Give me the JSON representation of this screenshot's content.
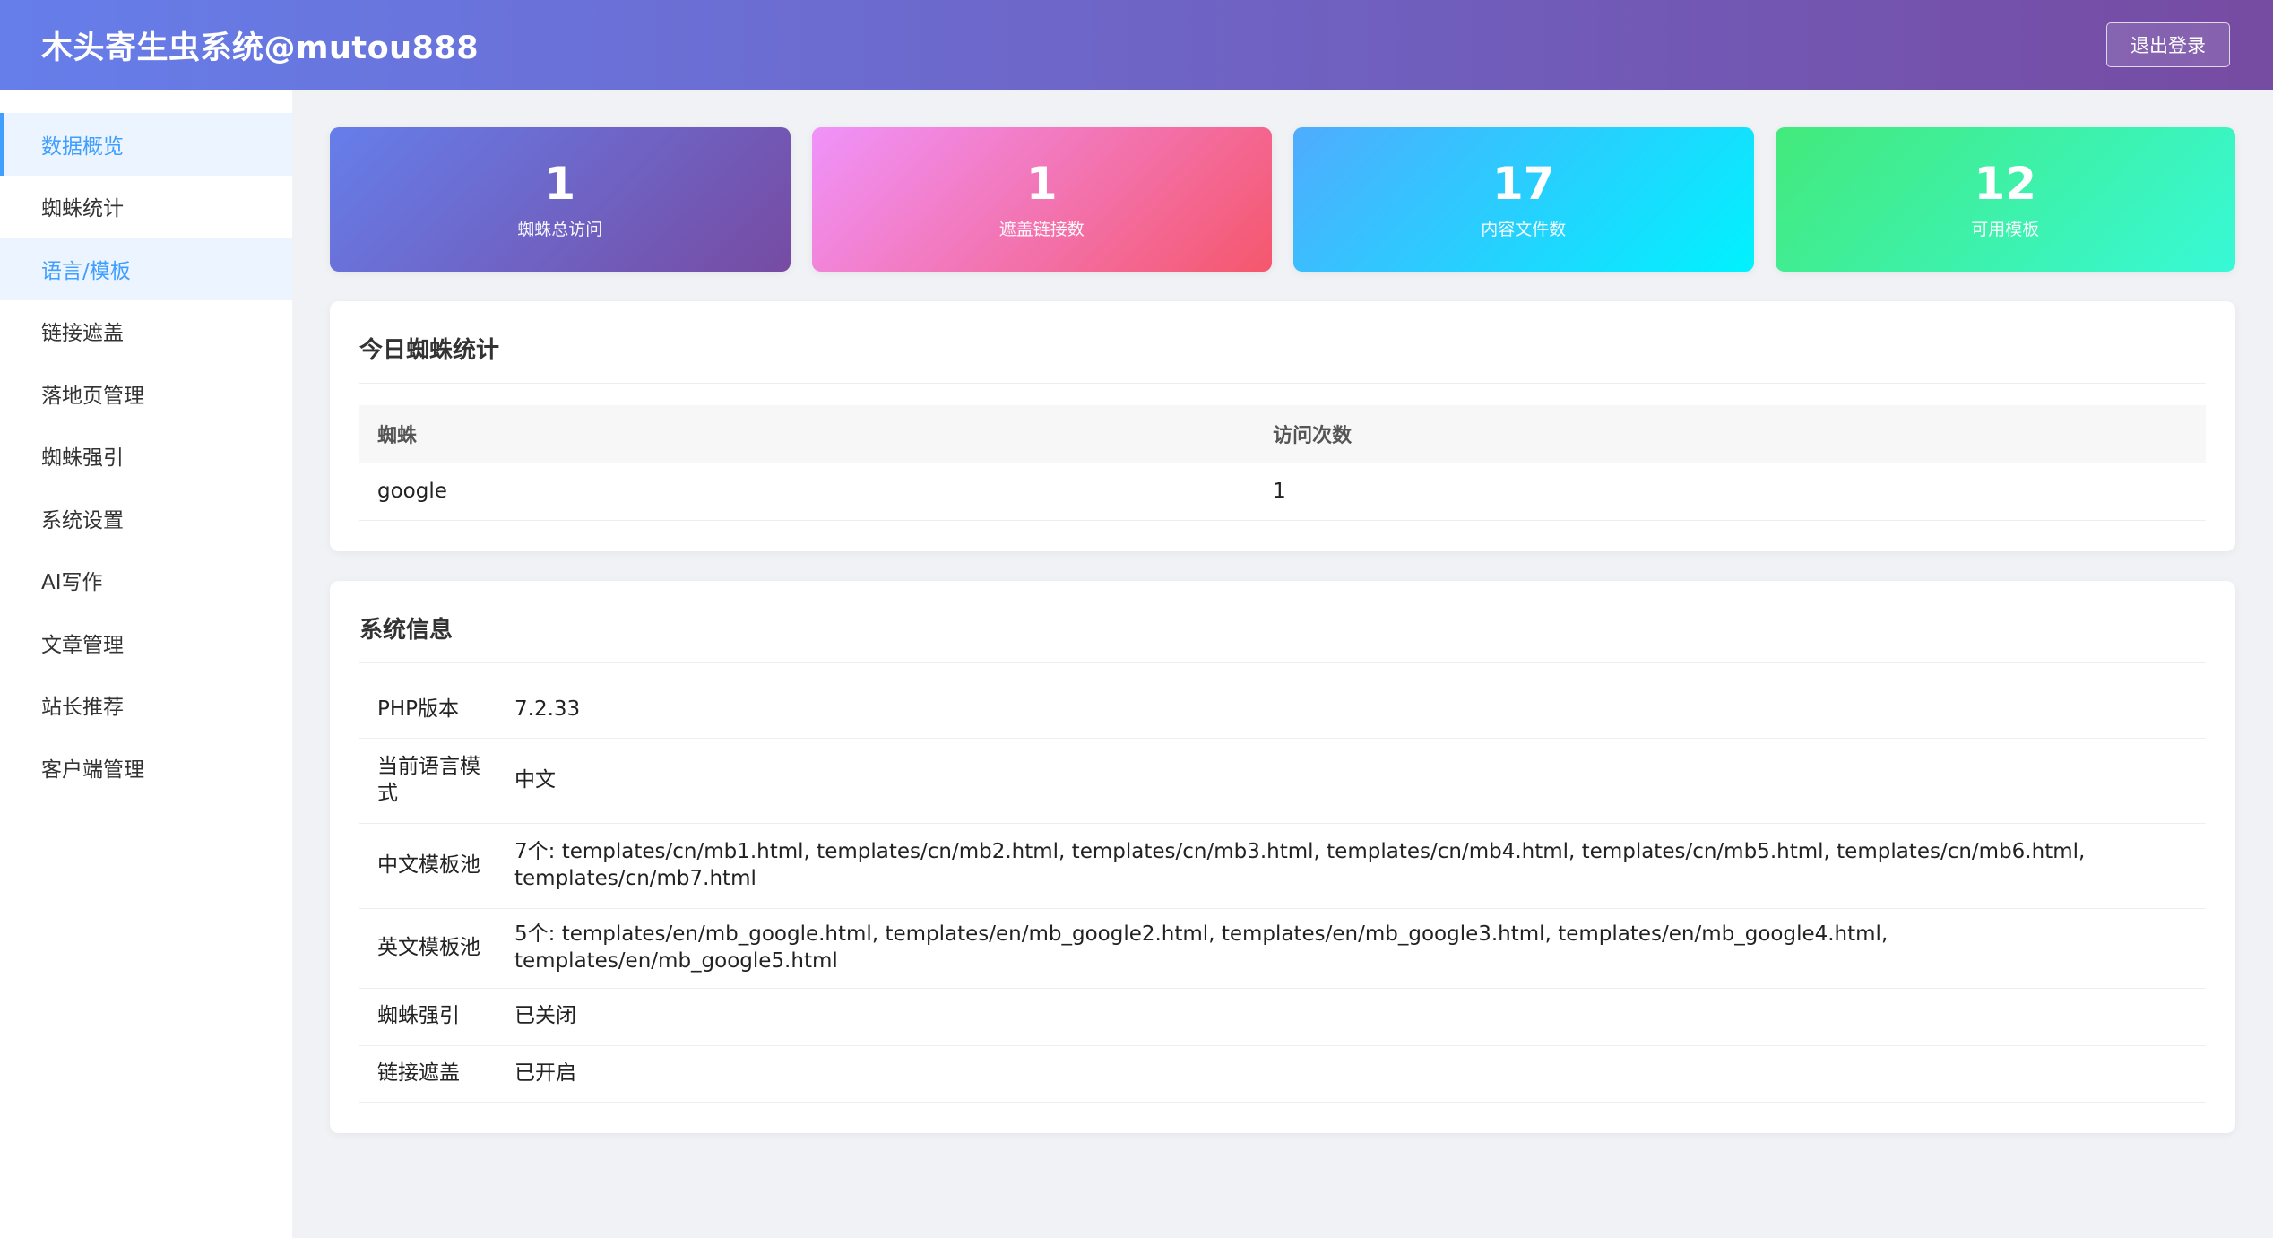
{
  "header": {
    "title": "木头寄生虫系统@mutou888",
    "logout_label": "退出登录"
  },
  "sidebar": {
    "items": [
      {
        "label": "数据概览"
      },
      {
        "label": "蜘蛛统计"
      },
      {
        "label": "语言/模板"
      },
      {
        "label": "链接遮盖"
      },
      {
        "label": "落地页管理"
      },
      {
        "label": "蜘蛛强引"
      },
      {
        "label": "系统设置"
      },
      {
        "label": "AI写作"
      },
      {
        "label": "文章管理"
      },
      {
        "label": "站长推荐"
      },
      {
        "label": "客户端管理"
      }
    ]
  },
  "stats": [
    {
      "value": "1",
      "label": "蜘蛛总访问"
    },
    {
      "value": "1",
      "label": "遮盖链接数"
    },
    {
      "value": "17",
      "label": "内容文件数"
    },
    {
      "value": "12",
      "label": "可用模板"
    }
  ],
  "spider_today": {
    "title": "今日蜘蛛统计",
    "columns": [
      "蜘蛛",
      "访问次数"
    ],
    "rows": [
      {
        "spider": "google",
        "count": "1"
      }
    ]
  },
  "system_info": {
    "title": "系统信息",
    "rows": [
      {
        "key": "PHP版本",
        "value": "7.2.33"
      },
      {
        "key": "当前语言模式",
        "value": "中文"
      },
      {
        "key": "中文模板池",
        "value": "7个: templates/cn/mb1.html, templates/cn/mb2.html, templates/cn/mb3.html, templates/cn/mb4.html, templates/cn/mb5.html, templates/cn/mb6.html, templates/cn/mb7.html"
      },
      {
        "key": "英文模板池",
        "value": "5个: templates/en/mb_google.html, templates/en/mb_google2.html, templates/en/mb_google3.html, templates/en/mb_google4.html, templates/en/mb_google5.html"
      },
      {
        "key": "蜘蛛强引",
        "value": "已关闭"
      },
      {
        "key": "链接遮盖",
        "value": "已开启"
      }
    ]
  },
  "colors": {
    "accent": "#409eff",
    "status_green": "#52c41a",
    "header_gradient": [
      "#667eea",
      "#764ba2"
    ],
    "stat_gradients": [
      [
        "#667eea",
        "#764ba2"
      ],
      [
        "#f093fb",
        "#f5576c"
      ],
      [
        "#4facfe",
        "#00f2fe"
      ],
      [
        "#43e97b",
        "#38f9d7"
      ]
    ]
  }
}
